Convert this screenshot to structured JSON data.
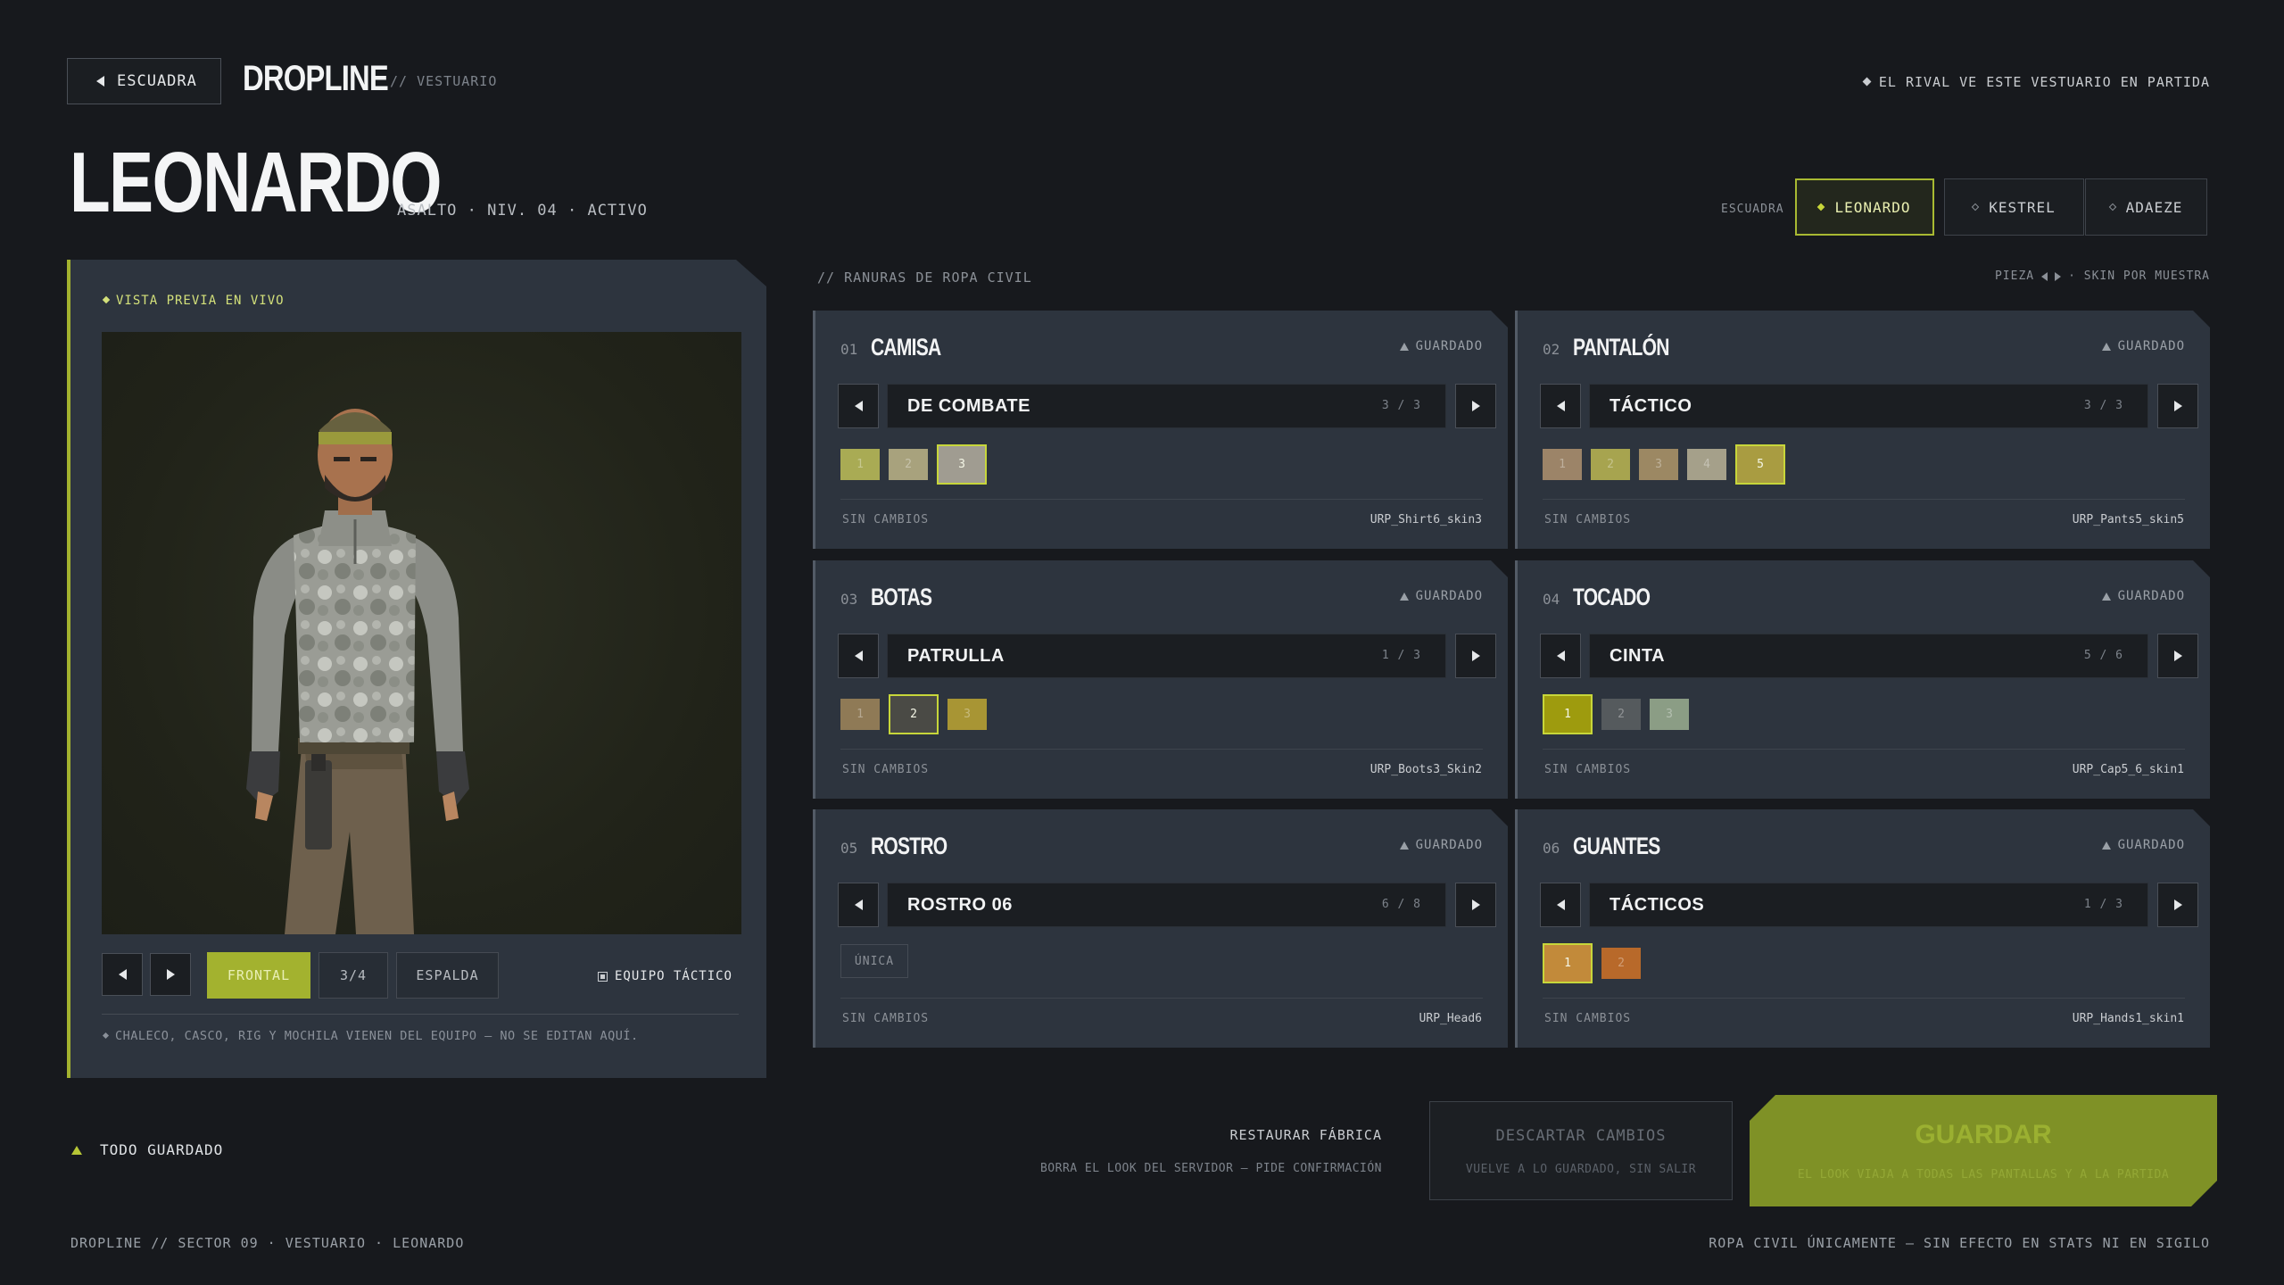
{
  "header": {
    "back_label": "ESCUADRA",
    "brand": "DROPLINE",
    "crumb": "// VESTUARIO",
    "rival_note": "EL RIVAL VE ESTE VESTUARIO EN PARTIDA"
  },
  "character": {
    "name": "LEONARDO",
    "subtitle": "ASALTO · NIV. 04 · ACTIVO"
  },
  "squad": {
    "label": "ESCUADRA",
    "members": [
      "LEONARDO",
      "KESTREL",
      "ADAEZE"
    ],
    "active": "LEONARDO"
  },
  "preview": {
    "live_label": "VISTA PREVIA EN VIVO",
    "angles": [
      "FRONTAL",
      "3/4",
      "ESPALDA"
    ],
    "active_angle": "FRONTAL",
    "equip_label": "EQUIPO TÁCTICO",
    "note": "CHALECO, CASCO, RIG Y MOCHILA VIENEN DEL EQUIPO — NO SE EDITAN AQUÍ."
  },
  "slots_section": {
    "title": "// RANURAS DE ROPA CIVIL",
    "hint_left": "PIEZA",
    "hint_right": "· SKIN POR MUESTRA"
  },
  "slots": [
    {
      "num": "01",
      "name": "CAMISA",
      "saved": "GUARDADO",
      "option": "DE COMBATE",
      "count": "3 / 3",
      "swatches": [
        {
          "label": "1",
          "color": "#a9ab54"
        },
        {
          "label": "2",
          "color": "#a8a27d"
        },
        {
          "label": "3",
          "color": "#a09c91"
        }
      ],
      "selected": 2,
      "status": "SIN CAMBIOS",
      "asset": "URP_Shirt6_skin3"
    },
    {
      "num": "02",
      "name": "PANTALÓN",
      "saved": "GUARDADO",
      "option": "TÁCTICO",
      "count": "3 / 3",
      "swatches": [
        {
          "label": "1",
          "color": "#9c8468"
        },
        {
          "label": "2",
          "color": "#a7a44f"
        },
        {
          "label": "3",
          "color": "#9c8863"
        },
        {
          "label": "4",
          "color": "#a5a08a"
        },
        {
          "label": "5",
          "color": "#a99c41"
        }
      ],
      "selected": 4,
      "status": "SIN CAMBIOS",
      "asset": "URP_Pants5_skin5"
    },
    {
      "num": "03",
      "name": "BOTAS",
      "saved": "GUARDADO",
      "option": "PATRULLA",
      "count": "1 / 3",
      "swatches": [
        {
          "label": "1",
          "color": "#8f7a56"
        },
        {
          "label": "2",
          "color": "#4a4a45"
        },
        {
          "label": "3",
          "color": "#a89534"
        }
      ],
      "selected": 1,
      "status": "SIN CAMBIOS",
      "asset": "URP_Boots3_Skin2"
    },
    {
      "num": "04",
      "name": "TOCADO",
      "saved": "GUARDADO",
      "option": "CINTA",
      "count": "5 / 6",
      "swatches": [
        {
          "label": "1",
          "color": "#9e9b0e"
        },
        {
          "label": "2",
          "color": "#555a5d"
        },
        {
          "label": "3",
          "color": "#8b9d85"
        }
      ],
      "selected": 0,
      "status": "SIN CAMBIOS",
      "asset": "URP_Cap5_6_skin1"
    },
    {
      "num": "05",
      "name": "ROSTRO",
      "saved": "GUARDADO",
      "option": "ROSTRO 06",
      "count": "6 / 8",
      "unique": "ÚNICA",
      "swatches": [],
      "selected": -1,
      "status": "SIN CAMBIOS",
      "asset": "URP_Head6"
    },
    {
      "num": "06",
      "name": "GUANTES",
      "saved": "GUARDADO",
      "option": "TÁCTICOS",
      "count": "1 / 3",
      "swatches": [
        {
          "label": "1",
          "color": "#c28a3a"
        },
        {
          "label": "2",
          "color": "#b8692a"
        }
      ],
      "selected": 0,
      "status": "SIN CAMBIOS",
      "asset": "URP_Hands1_skin1"
    }
  ],
  "actions": {
    "saved_all": "TODO GUARDADO",
    "restore_label": "RESTAURAR FÁBRICA",
    "restore_sub": "BORRA EL LOOK DEL SERVIDOR — PIDE CONFIRMACIÓN",
    "discard_label": "DESCARTAR CAMBIOS",
    "discard_sub": "VUELVE A LO GUARDADO, SIN SALIR",
    "save_label": "GUARDAR",
    "save_sub": "EL LOOK VIAJA A TODAS LAS PANTALLAS Y A LA PARTIDA"
  },
  "footer": {
    "left": "DROPLINE // SECTOR 09 · VESTUARIO · LEONARDO",
    "right": "ROPA CIVIL ÚNICAMENTE — SIN EFECTO EN STATS NI EN SIGILO"
  },
  "colors": {
    "accent": "#a3b22f",
    "background": "#17191d",
    "panel": "#2d343e"
  }
}
